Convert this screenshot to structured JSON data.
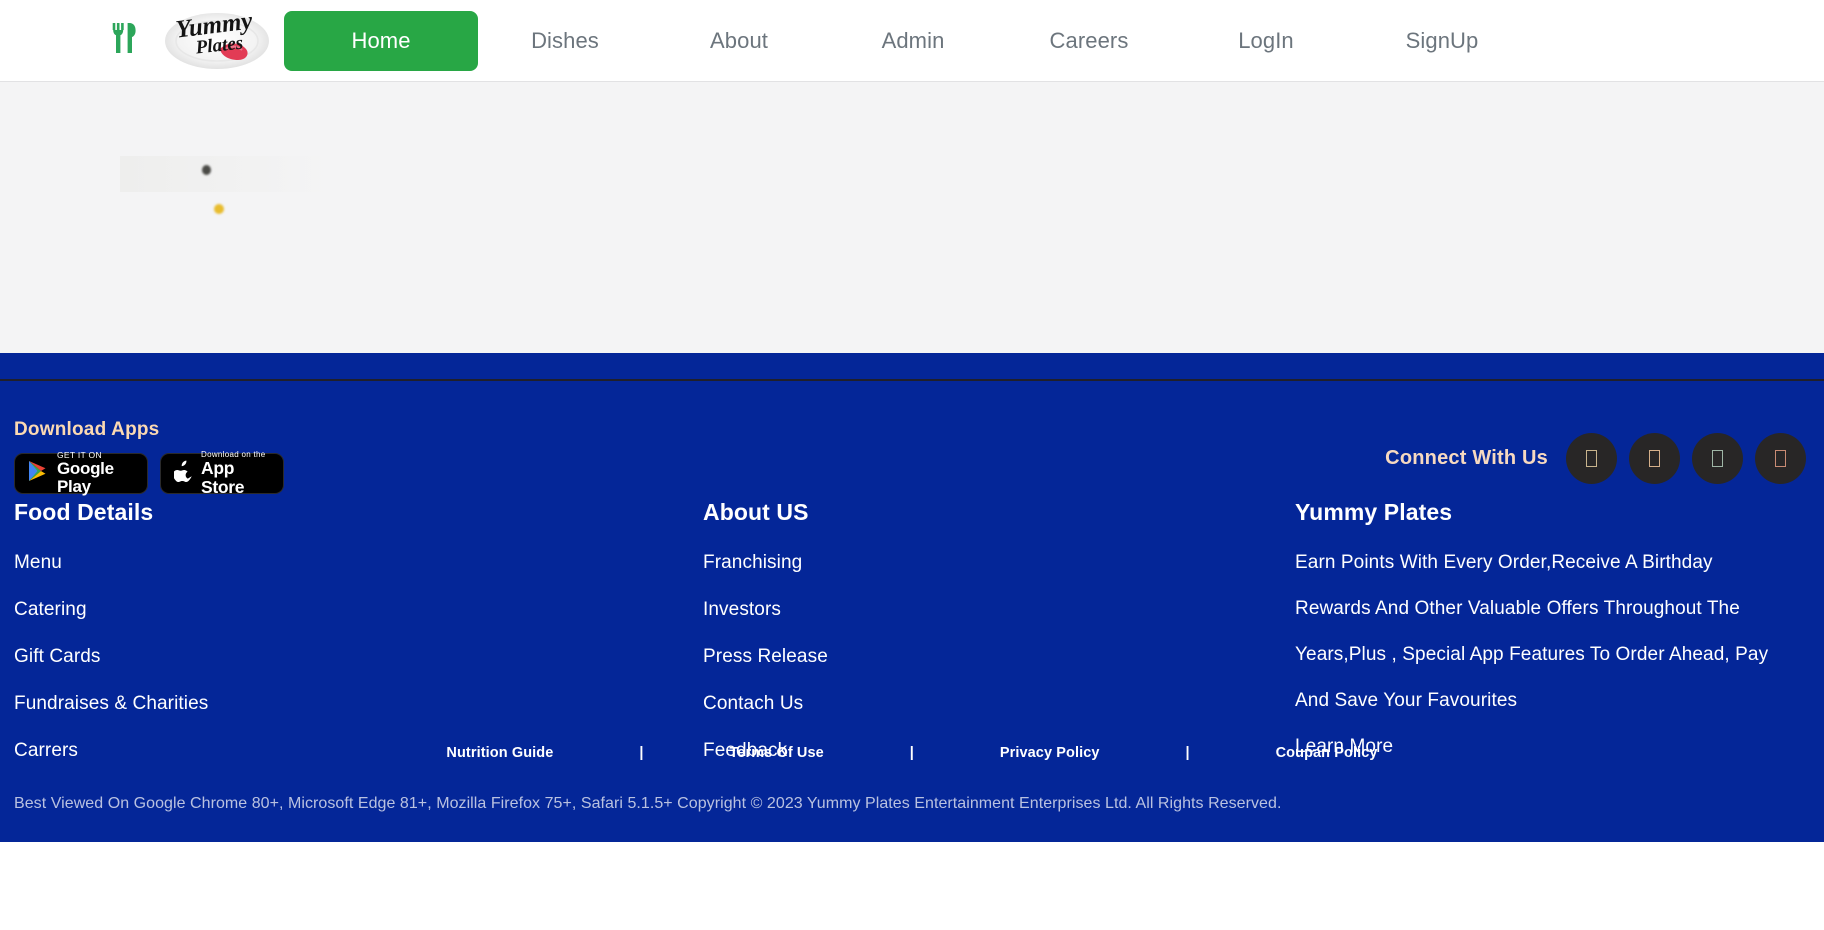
{
  "header": {
    "brand_name": "Yummy Plates",
    "cutlery_icon": "fork-knife-icon",
    "nav": [
      {
        "label": "Home",
        "active": true
      },
      {
        "label": "Dishes",
        "active": false
      },
      {
        "label": "About",
        "active": false
      },
      {
        "label": "Admin",
        "active": false
      },
      {
        "label": "Careers",
        "active": false
      },
      {
        "label": "LogIn",
        "active": false
      },
      {
        "label": "SignUp",
        "active": false
      }
    ]
  },
  "footer": {
    "apps": {
      "title": "Download Apps",
      "google_play": {
        "small": "GET IT ON",
        "big": "Google Play",
        "icon": "google-play-icon"
      },
      "app_store": {
        "small": "Download on the",
        "big": "App Store",
        "icon": "apple-icon"
      }
    },
    "connect": {
      "label": "Connect With Us",
      "icons": [
        "social-icon-1",
        "social-icon-2",
        "social-icon-3",
        "social-icon-4"
      ]
    },
    "columns": [
      {
        "heading": "Food Details",
        "links": [
          "Menu",
          "Catering",
          "Gift Cards",
          "Fundraises & Charities",
          "Carrers"
        ]
      },
      {
        "heading": "About US",
        "links": [
          "Franchising",
          "Investors",
          "Press Release",
          "Contach Us",
          "Feedback"
        ]
      },
      {
        "heading": "Yummy Plates",
        "links": [
          "Earn Points With Every Order,Receive A Birthday",
          "Rewards And Other Valuable Offers Throughout The",
          "Years,Plus , Special App Features To Order Ahead, Pay",
          "And Save Your Favourites",
          "Learn More"
        ]
      }
    ],
    "policies": [
      "Nutrition Guide",
      "Terms Of Use",
      "Privacy Policy",
      "Coupan Policy"
    ],
    "separator": "|",
    "copyright": "Best Viewed On Google Chrome 80+, Microsoft Edge 81+, Mozilla Firefox 75+, Safari 5.1.5+ Copyright © 2023 Yummy Plates Entertainment Enterprises Ltd. All Rights Reserved."
  },
  "colors": {
    "footer_blue": "#042698",
    "accent_green": "#28a745",
    "apps_title": "#fbd9b2",
    "nav_text": "#6c757d",
    "body_bg": "#f4f4f5"
  }
}
